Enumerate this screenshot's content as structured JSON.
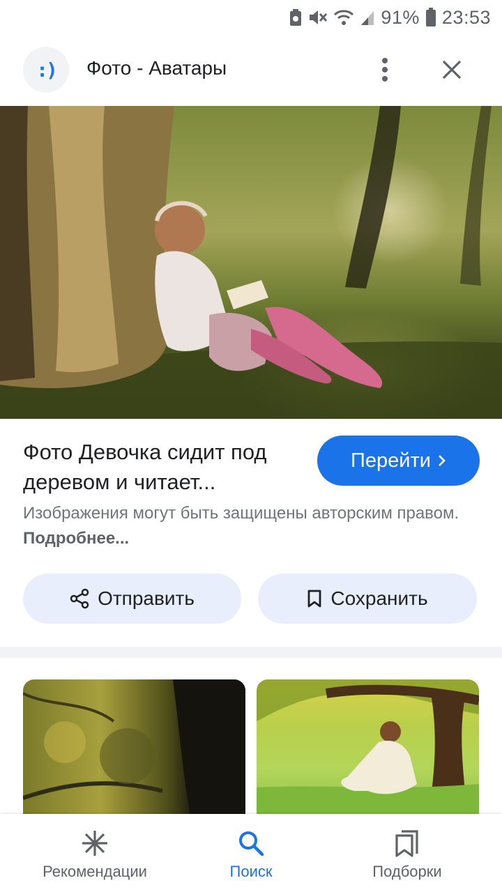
{
  "status_bar": {
    "battery_percent": "91%",
    "time": "23:53"
  },
  "header": {
    "logo_text": ":)",
    "title": "Фото - Аватары"
  },
  "result": {
    "title": "Фото Девочка сидит под деревом и читает...",
    "visit_label": "Перейти",
    "copyright_text": "Изображения могут быть защищены авторским правом.",
    "more_link": "Подробнее..."
  },
  "actions": {
    "share_label": "Отправить",
    "save_label": "Сохранить"
  },
  "bottom_nav": {
    "items": [
      {
        "label": "Рекомендации",
        "icon": "asterisk-icon",
        "active": false
      },
      {
        "label": "Поиск",
        "icon": "search-icon",
        "active": true
      },
      {
        "label": "Подборки",
        "icon": "collections-icon",
        "active": false
      }
    ]
  },
  "colors": {
    "accent": "#1a73e8",
    "action_bg": "#e8eefb",
    "text_secondary": "#70757a"
  }
}
